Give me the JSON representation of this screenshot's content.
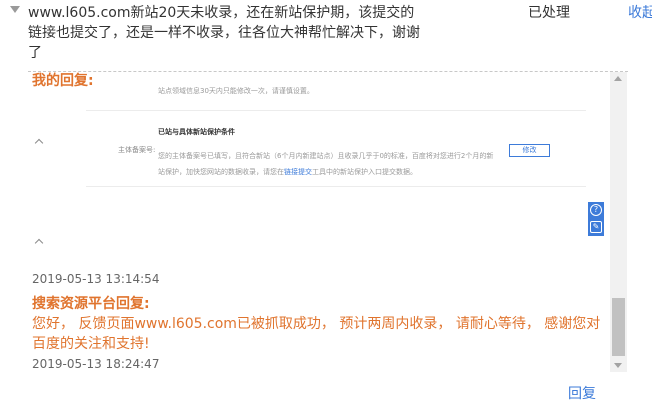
{
  "question": {
    "text": "www.l605.com新站20天未收录，还在新站保护期，该提交的链接也提交了，还是一样不收录，往各位大神帮忙解决下，谢谢了",
    "status": "已处理",
    "collapse_label": "收起"
  },
  "my_reply": {
    "label": "我的回复:",
    "embedded_screenshot": {
      "note": "站点领域信息30天内只能修改一次，请谨慎设置。",
      "field_label": "主体备案号:",
      "title": "已站与具体新站保护条件",
      "body_before_link": "您的主体备案号已填写，且符合新站（6个月内新建站点）且收录几乎于0的标准，百度将对您进行2个月的新站保护，加快您网站的数据收录，请您在",
      "body_link": "链接提交",
      "body_after_link": "工具中的新站保护入口提交数据。",
      "button": "修改"
    },
    "timestamp": "2019-05-13 13:14:54"
  },
  "platform_reply": {
    "label": "搜索资源平台回复:",
    "text": "您好， 反馈页面www.l605.com已被抓取成功， 预计两周内收录， 请耐心等待， 感谢您对百度的关注和支持!",
    "timestamp": "2019-05-13 18:24:47"
  },
  "side_tools": {
    "help_glyph": "?",
    "edit_glyph": "✎"
  },
  "reply_link": "回复",
  "colors": {
    "accent_orange": "#e0742e",
    "link_blue": "#3d7bd9"
  }
}
